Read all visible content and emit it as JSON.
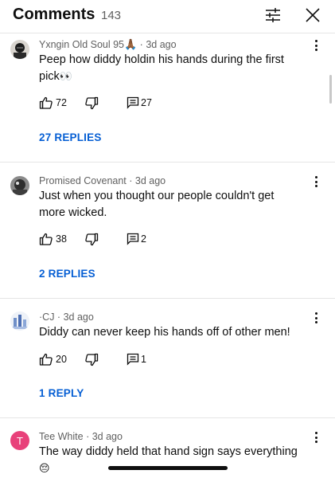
{
  "header": {
    "title": "Comments",
    "count": "143"
  },
  "comments": [
    {
      "author": "Yxngin Old Soul 95",
      "author_emoji": "🙏🏾",
      "time": "3d ago",
      "text": "Peep how diddy holdin his hands during the first pick",
      "text_emoji": "👀",
      "likes": "72",
      "replies": "27",
      "replies_label": "27 REPLIES"
    },
    {
      "author": "Promised Covenant",
      "time": "3d ago",
      "text": "Just when you thought our people couldn't get more wicked.",
      "likes": "38",
      "replies": "2",
      "replies_label": "2 REPLIES"
    },
    {
      "author": "·CJ",
      "time": "3d ago",
      "text": "Diddy can never keep his hands off of other men!",
      "likes": "20",
      "replies": "1",
      "replies_label": "1 REPLY"
    },
    {
      "author": "Tee White",
      "time": "3d ago",
      "avatar_letter": "T",
      "text": "The way diddy held that hand sign says everything",
      "text_emoji": "😔"
    }
  ],
  "colors": {
    "link_blue": "#065fd4",
    "meta_gray": "#606060",
    "avatar_pink": "#e8417a"
  },
  "icons": [
    "filter-sliders-icon",
    "close-icon",
    "thumbs-up-icon",
    "thumbs-down-icon",
    "reply-comment-icon",
    "more-vertical-icon"
  ]
}
